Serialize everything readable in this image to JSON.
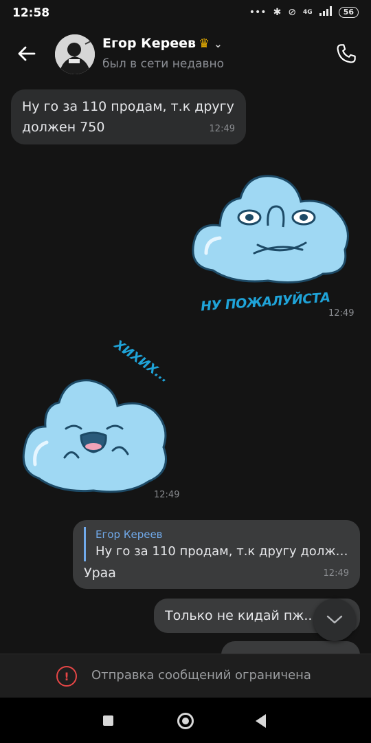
{
  "status_bar": {
    "time": "12:58",
    "network": "4G",
    "battery": "56"
  },
  "header": {
    "contact_name": "Егор Кереев",
    "crown_icon": "crown-icon",
    "status": "был в сети недавно"
  },
  "messages": [
    {
      "type": "text",
      "direction": "incoming",
      "text": "Ну го за 110 продам, т.к другу должен 750",
      "time": "12:49"
    },
    {
      "type": "sticker",
      "direction": "outgoing",
      "caption": "НУ ПОЖАЛУЙСТА",
      "time": "12:49"
    },
    {
      "type": "sticker",
      "direction": "incoming",
      "caption": "ХИХИХ...",
      "time": "12:49"
    },
    {
      "type": "reply",
      "direction": "outgoing",
      "reply_author": "Егор Кереев",
      "reply_text": "Ну го за 110 продам, т.к другу долже...",
      "text": "Ураа",
      "time": "12:49"
    },
    {
      "type": "text",
      "direction": "outgoing",
      "text": "Только не кидай пж..."
    }
  ],
  "restricted_notice": "Отправка сообщений ограничена",
  "colors": {
    "background": "#141414",
    "incoming_bubble": "#2c2d2e",
    "outgoing_bubble": "#3a3b3c",
    "accent": "#71aaeb",
    "sticker_blue": "#9fd8f3",
    "sticker_caption": "#1fa3d8",
    "warning": "#e64646"
  }
}
